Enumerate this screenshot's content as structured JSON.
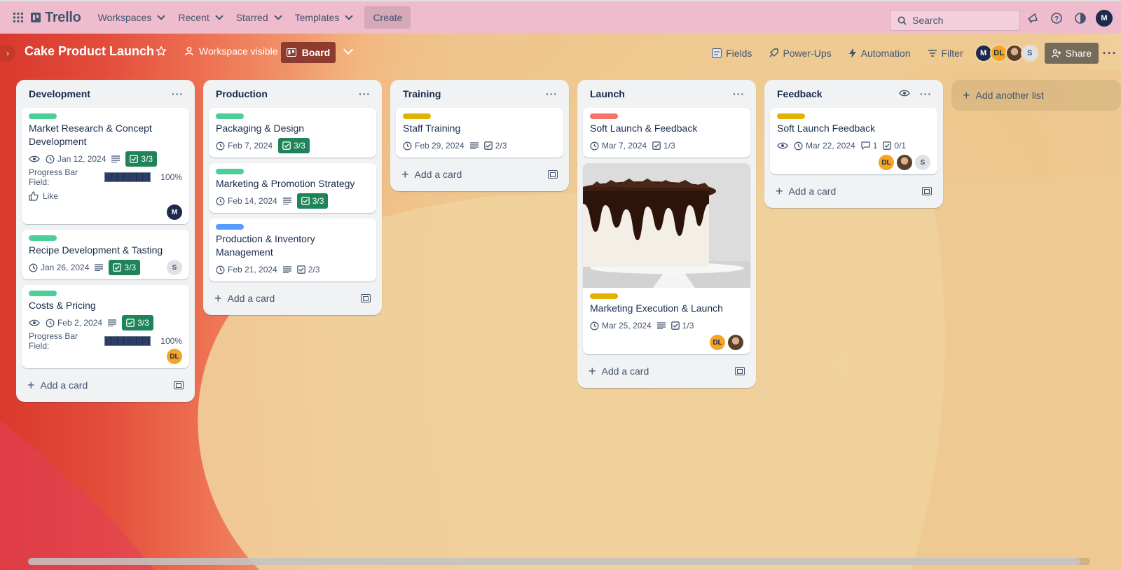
{
  "nav": {
    "workspaces": "Workspaces",
    "recent": "Recent",
    "starred": "Starred",
    "templates": "Templates",
    "create": "Create",
    "logo": "Trello",
    "search_placeholder": "Search",
    "account_initial": "M"
  },
  "board": {
    "title": "Cake Product Launch",
    "visibility": "Workspace visible",
    "view": "Board",
    "fields": "Fields",
    "powerups": "Power-Ups",
    "automation": "Automation",
    "filter": "Filter",
    "share": "Share",
    "members": [
      "M",
      "DL",
      "",
      "S"
    ]
  },
  "lists": [
    {
      "title": "Development",
      "add_card": "Add a card",
      "cards": [
        {
          "title": "Market Research & Concept Development",
          "label_color": "#4bce97",
          "due": "Jan 12, 2024",
          "checklist": "3/3",
          "progress_label": "Progress Bar Field:",
          "progress": "100%",
          "like": "Like",
          "member": "M"
        },
        {
          "title": "Recipe Development & Tasting",
          "label_color": "#4bce97",
          "due": "Jan 26, 2024",
          "checklist": "3/3",
          "member": "S"
        },
        {
          "title": "Costs & Pricing",
          "label_color": "#4bce97",
          "due": "Feb 2, 2024",
          "checklist": "3/3",
          "progress_label": "Progress Bar Field:",
          "progress": "100%",
          "member": "DL"
        }
      ]
    },
    {
      "title": "Production",
      "add_card": "Add a card",
      "cards": [
        {
          "title": "Packaging & Design",
          "label_color": "#4bce97",
          "due": "Feb 7, 2024",
          "checklist": "3/3"
        },
        {
          "title": "Marketing & Promotion Strategy",
          "label_color": "#4bce97",
          "due": "Feb 14, 2024",
          "checklist": "3/3"
        },
        {
          "title": "Production & Inventory Management",
          "label_color": "#579dff",
          "due": "Feb 21, 2024",
          "checklist": "2/3"
        }
      ]
    },
    {
      "title": "Training",
      "add_card": "Add a card",
      "cards": [
        {
          "title": "Staff Training",
          "label_color": "#e2b203",
          "due": "Feb 29, 2024",
          "checklist": "2/3"
        }
      ]
    },
    {
      "title": "Launch",
      "add_card": "Add a card",
      "cards": [
        {
          "title": "Soft Launch & Feedback",
          "label_color": "#f87168",
          "due": "Mar 7, 2024",
          "checklist": "1/3"
        },
        {
          "title": "Marketing Execution & Launch",
          "label_color": "#e2b203",
          "due": "Mar 25, 2024",
          "checklist": "1/3",
          "members": [
            "DL",
            ""
          ]
        }
      ]
    },
    {
      "title": "Feedback",
      "add_card": "Add a card",
      "cards": [
        {
          "title": "Soft Launch Feedback",
          "label_color": "#e2b203",
          "due": "Mar 22, 2024",
          "comments": "1",
          "checklist": "0/1",
          "members": [
            "DL",
            "",
            "S"
          ]
        }
      ]
    }
  ],
  "add_list": "Add another list",
  "colors": {
    "nav_bg": "#eebccd",
    "checklist_complete": "#1f845a",
    "board_view_btn": "#8e3b2f"
  },
  "icons": [
    "apps-grid-icon",
    "star-icon",
    "people-icon",
    "board-icon",
    "chevron-down-icon",
    "fields-icon",
    "rocket-icon",
    "bolt-icon",
    "filter-icon",
    "share-icon",
    "more-icon",
    "search-icon",
    "megaphone-icon",
    "help-icon",
    "theme-icon",
    "eye-icon",
    "clock-icon",
    "description-icon",
    "checklist-icon",
    "comment-icon",
    "like-icon",
    "plus-icon",
    "template-icon"
  ]
}
